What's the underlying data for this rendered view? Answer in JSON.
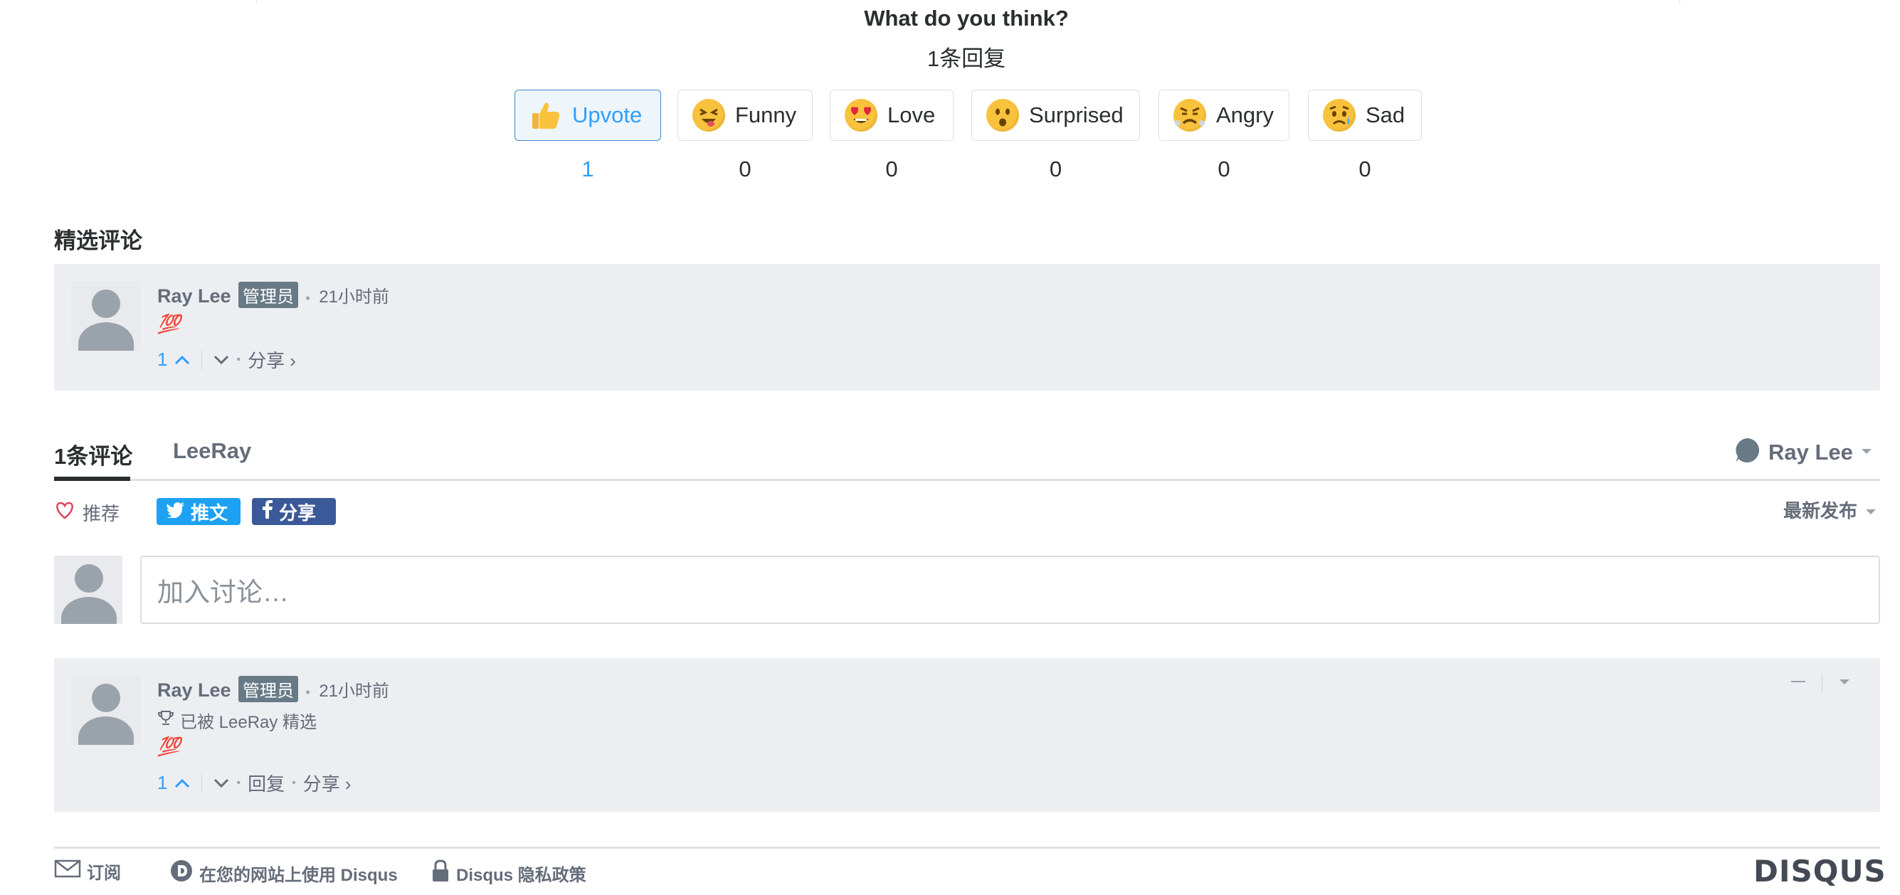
{
  "header": {
    "question": "What do you think?",
    "responses": "1条回复"
  },
  "reactions": [
    {
      "label": "Upvote",
      "count": "1",
      "icon": "thumbs-up-icon",
      "active": true
    },
    {
      "label": "Funny",
      "count": "0",
      "icon": "funny-face-icon"
    },
    {
      "label": "Love",
      "count": "0",
      "icon": "heart-eyes-icon"
    },
    {
      "label": "Surprised",
      "count": "0",
      "icon": "surprised-face-icon"
    },
    {
      "label": "Angry",
      "count": "0",
      "icon": "angry-face-icon"
    },
    {
      "label": "Sad",
      "count": "0",
      "icon": "sad-face-icon"
    }
  ],
  "featured": {
    "title": "精选评论",
    "comment": {
      "author": "Ray Lee",
      "badge": "管理员",
      "time": "21小时前",
      "body": "💯",
      "votes": "1",
      "share": "分享 ›"
    }
  },
  "tabs": {
    "comments": "1条评论",
    "site": "LeeRay",
    "user": "Ray Lee"
  },
  "actions": {
    "recommend": "推荐",
    "tweet": "推文",
    "share": "分享",
    "sort": "最新发布"
  },
  "composer": {
    "placeholder": "加入讨论…"
  },
  "comment": {
    "author": "Ray Lee",
    "badge": "管理员",
    "time": "21小时前",
    "featured_note": "已被 LeeRay 精选",
    "body": "💯",
    "votes": "1",
    "reply": "回复",
    "share": "分享 ›"
  },
  "footer": {
    "subscribe": "订阅",
    "use_disqus": "在您的网站上使用 Disqus",
    "privacy": "Disqus 隐私政策",
    "logo": "DISQUS"
  },
  "colors": {
    "accent": "#2e9fff",
    "twitter": "#1da1f2",
    "facebook": "#3b5998",
    "comment_bg": "#eceef1"
  }
}
